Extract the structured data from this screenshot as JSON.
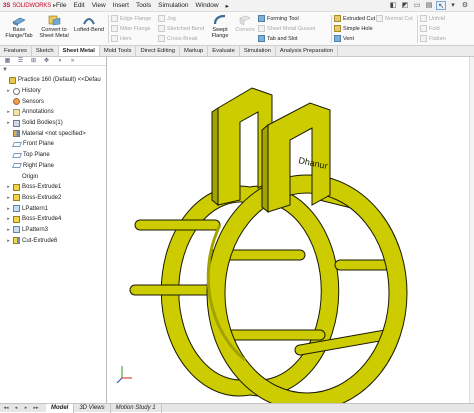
{
  "app": {
    "logo_ds": "3S",
    "logo_brand": "SOLIDWORKS",
    "logo_arrow": "▸"
  },
  "menu": [
    "File",
    "Edit",
    "View",
    "Insert",
    "Tools",
    "Simulation",
    "Window",
    "▸"
  ],
  "title_icons": [
    "◧",
    "◩",
    "▭",
    "▤",
    "↖",
    "▾",
    "⚙"
  ],
  "ribbon": {
    "base_flange": "Base Flange/Tab",
    "convert": "Convert to Sheet Metal",
    "lofted": "Lofted-Bend",
    "col1": [
      "Edge Flange",
      "Miter Flange",
      "Hem"
    ],
    "col2": [
      "Jog",
      "Sketched Bend",
      "Cross-Break"
    ],
    "swept": "Swept Flange",
    "corners": "Corners",
    "col3": [
      "Forming Tool",
      "Sheet Metal Gusset",
      "Tab and Slot"
    ],
    "col4": [
      "Extruded Cut",
      "Simple Hole",
      "Vent"
    ],
    "col5": [
      "Normal Cut"
    ],
    "col6": [
      "Unfold",
      "Fold",
      "Flatten"
    ]
  },
  "tabs": [
    "Features",
    "Sketch",
    "Sheet Metal",
    "Mold Tools",
    "Direct Editing",
    "Markup",
    "Evaluate",
    "Simulation",
    "Analysis Preparation"
  ],
  "active_tab": "Sheet Metal",
  "panel_tabs": [
    "▦",
    "☰",
    "⊞",
    "✥",
    "◑",
    "»"
  ],
  "filter_icon": "▼",
  "tree": [
    {
      "label": "Practice 160 (Default) <<Defau",
      "icon": "part",
      "exp": ""
    },
    {
      "label": "History",
      "icon": "hist",
      "exp": "▸"
    },
    {
      "label": "Sensors",
      "icon": "sens",
      "exp": ""
    },
    {
      "label": "Annotations",
      "icon": "ann",
      "exp": "▸"
    },
    {
      "label": "Solid Bodies(1)",
      "icon": "solid",
      "exp": "▸"
    },
    {
      "label": "Material <not specified>",
      "icon": "mat",
      "exp": ""
    },
    {
      "label": "Front Plane",
      "icon": "plane",
      "exp": ""
    },
    {
      "label": "Top Plane",
      "icon": "plane",
      "exp": ""
    },
    {
      "label": "Right Plane",
      "icon": "plane",
      "exp": ""
    },
    {
      "label": "Origin",
      "icon": "origin",
      "exp": ""
    },
    {
      "label": "Boss-Extrude1",
      "icon": "feat",
      "exp": "▸"
    },
    {
      "label": "Boss-Extrude2",
      "icon": "feat",
      "exp": "▸"
    },
    {
      "label": "LPattern1",
      "icon": "pat",
      "exp": "▸"
    },
    {
      "label": "Boss-Extrude4",
      "icon": "feat",
      "exp": "▸"
    },
    {
      "label": "LPattern3",
      "icon": "pat",
      "exp": "▸"
    },
    {
      "label": "Cut-Extrude6",
      "icon": "cut",
      "exp": "▸"
    }
  ],
  "model_text": "Dhanur",
  "bottom_tabs": [
    "Model",
    "3D Views",
    "Motion Study 1"
  ],
  "active_bottom": "Model",
  "bottom_nav": [
    "◂◂",
    "◂",
    "▸",
    "▸▸"
  ],
  "colors": {
    "model": "#cccc00",
    "model_dark": "#a3a300",
    "model_light": "#e4e43a",
    "edge": "#1a1a00"
  }
}
